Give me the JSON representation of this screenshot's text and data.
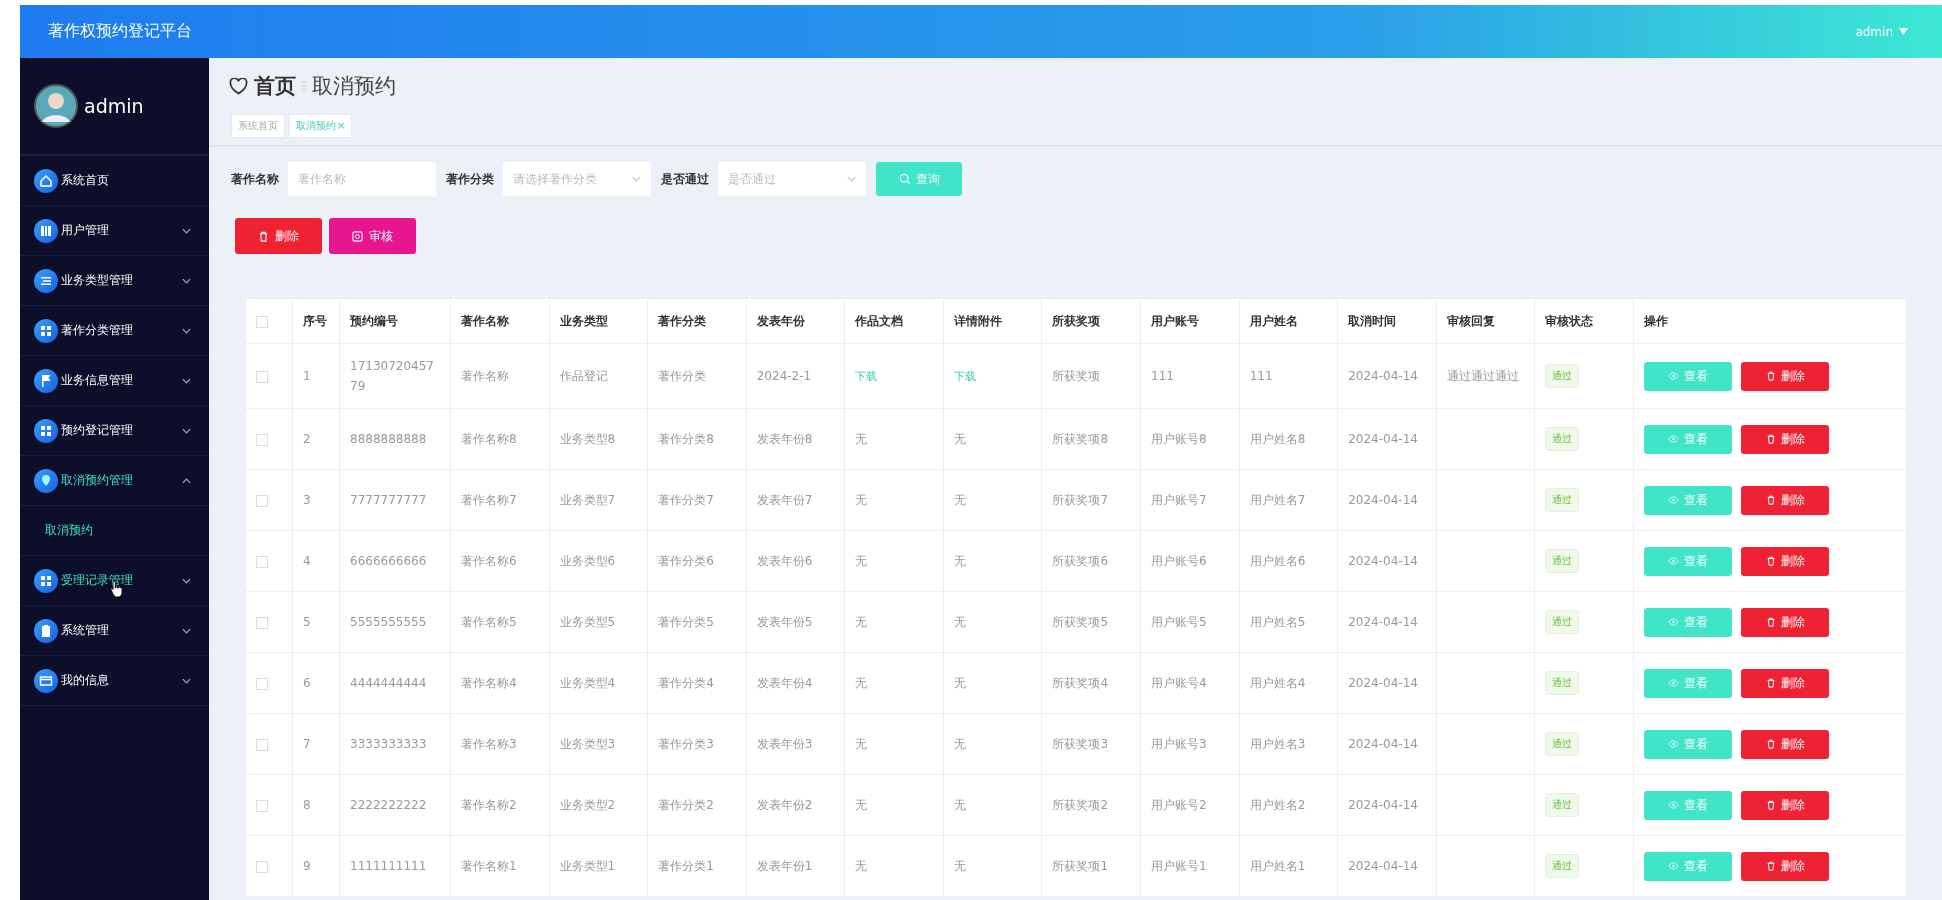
{
  "header": {
    "title": "著作权预约登记平台",
    "user": "admin"
  },
  "sidebar": {
    "user": "admin",
    "items": [
      {
        "label": "系统首页",
        "highlighted": false,
        "has_children": false
      },
      {
        "label": "用户管理",
        "expanded": false,
        "highlighted": false,
        "has_children": true
      },
      {
        "label": "业务类型管理",
        "expanded": false,
        "highlighted": false,
        "has_children": true
      },
      {
        "label": "著作分类管理",
        "expanded": false,
        "highlighted": false,
        "has_children": true
      },
      {
        "label": "业务信息管理",
        "expanded": false,
        "highlighted": false,
        "has_children": true
      },
      {
        "label": "预约登记管理",
        "expanded": false,
        "highlighted": false,
        "has_children": true
      },
      {
        "label": "取消预约管理",
        "expanded": true,
        "highlighted": true,
        "has_children": true,
        "children": [
          {
            "label": "取消预约",
            "selected": true
          }
        ]
      },
      {
        "label": "受理记录管理",
        "expanded": false,
        "highlighted": true,
        "has_children": true
      },
      {
        "label": "系统管理",
        "expanded": false,
        "highlighted": false,
        "has_children": true
      },
      {
        "label": "我的信息",
        "expanded": false,
        "highlighted": false,
        "has_children": true
      }
    ]
  },
  "breadcrumb": {
    "home": "首页",
    "current": "取消预约"
  },
  "tabs": [
    {
      "label": "系统首页",
      "selected": false,
      "closable": false
    },
    {
      "label": "取消预约",
      "selected": true,
      "closable": true,
      "close": "×"
    }
  ],
  "search": {
    "fields": [
      {
        "label": "著作名称",
        "kind": "input",
        "placeholder": "著作名称"
      },
      {
        "label": "著作分类",
        "kind": "select",
        "placeholder": "请选择著作分类"
      },
      {
        "label": "是否通过",
        "kind": "select",
        "placeholder": "是否通过"
      }
    ],
    "button": "查询"
  },
  "actions": [
    {
      "label": "删除",
      "kind": "delete"
    },
    {
      "label": "审核",
      "kind": "review"
    }
  ],
  "table": {
    "columns": [
      "序号",
      "预约编号",
      "著作名称",
      "业务类型",
      "著作分类",
      "发表年份",
      "作品文档",
      "详情附件",
      "所获奖项",
      "用户账号",
      "用户姓名",
      "取消时间",
      "审核回复",
      "审核状态",
      "操作"
    ],
    "header_checked": false,
    "rows": [
      {
        "checked": false,
        "cells": [
          "1",
          "1713072045779",
          "著作名称",
          "作品登记",
          "著作分类",
          "2024-2-1",
          {
            "kind": "link",
            "text": "下载"
          },
          {
            "kind": "link",
            "text": "下载"
          },
          "所获奖项",
          "111",
          "111",
          "2024-04-14"
        ],
        "reply": "通过通过通过",
        "status": "通过",
        "buttons": [
          "查看",
          "删除"
        ]
      },
      {
        "checked": false,
        "cells": [
          "2",
          "8888888888",
          "著作名称8",
          "业务类型8",
          "著作分类8",
          "发表年份8",
          "无",
          "无",
          "所获奖项8",
          "用户账号8",
          "用户姓名8",
          "2024-04-14"
        ],
        "status": "通过",
        "buttons": [
          "查看",
          "删除"
        ]
      },
      {
        "checked": false,
        "cells": [
          "3",
          "7777777777",
          "著作名称7",
          "业务类型7",
          "著作分类7",
          "发表年份7",
          "无",
          "无",
          "所获奖项7",
          "用户账号7",
          "用户姓名7",
          "2024-04-14"
        ],
        "status": "通过",
        "buttons": [
          "查看",
          "删除"
        ]
      },
      {
        "checked": false,
        "cells": [
          "4",
          "6666666666",
          "著作名称6",
          "业务类型6",
          "著作分类6",
          "发表年份6",
          "无",
          "无",
          "所获奖项6",
          "用户账号6",
          "用户姓名6",
          "2024-04-14"
        ],
        "status": "通过",
        "buttons": [
          "查看",
          "删除"
        ]
      },
      {
        "checked": false,
        "cells": [
          "5",
          "5555555555",
          "著作名称5",
          "业务类型5",
          "著作分类5",
          "发表年份5",
          "无",
          "无",
          "所获奖项5",
          "用户账号5",
          "用户姓名5",
          "2024-04-14"
        ],
        "status": "通过",
        "buttons": [
          "查看",
          "删除"
        ]
      },
      {
        "checked": false,
        "cells": [
          "6",
          "4444444444",
          "著作名称4",
          "业务类型4",
          "著作分类4",
          "发表年份4",
          "无",
          "无",
          "所获奖项4",
          "用户账号4",
          "用户姓名4",
          "2024-04-14"
        ],
        "status": "通过",
        "buttons": [
          "查看",
          "删除"
        ]
      },
      {
        "checked": false,
        "cells": [
          "7",
          "3333333333",
          "著作名称3",
          "业务类型3",
          "著作分类3",
          "发表年份3",
          "无",
          "无",
          "所获奖项3",
          "用户账号3",
          "用户姓名3",
          "2024-04-14"
        ],
        "status": "通过",
        "buttons": [
          "查看",
          "删除"
        ]
      },
      {
        "checked": false,
        "cells": [
          "8",
          "2222222222",
          "著作名称2",
          "业务类型2",
          "著作分类2",
          "发表年份2",
          "无",
          "无",
          "所获奖项2",
          "用户账号2",
          "用户姓名2",
          "2024-04-14"
        ],
        "status": "通过",
        "buttons": [
          "查看",
          "删除"
        ]
      },
      {
        "checked": false,
        "cells": [
          "9",
          "1111111111",
          "著作名称1",
          "业务类型1",
          "著作分类1",
          "发表年份1",
          "无",
          "无",
          "所获奖项1",
          "用户账号1",
          "用户姓名1",
          "2024-04-14"
        ],
        "status": "通过",
        "buttons": [
          "查看",
          "删除"
        ]
      }
    ]
  }
}
